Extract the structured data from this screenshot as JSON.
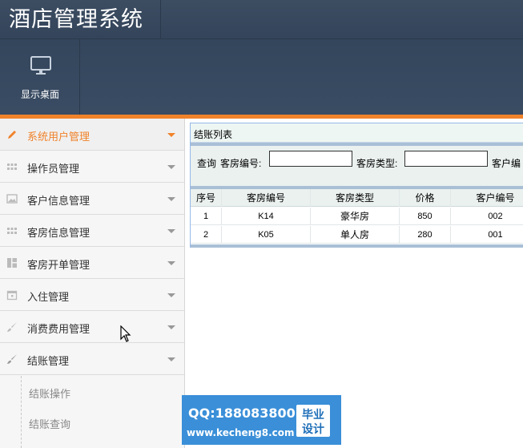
{
  "app": {
    "title": "酒店管理系统"
  },
  "toolbar": {
    "desktop_label": "显示桌面",
    "desktop_icon": "monitor-icon"
  },
  "sidebar": {
    "items": [
      {
        "label": "系统用户管理",
        "icon": "pencil-icon",
        "active": true
      },
      {
        "label": "操作员管理",
        "icon": "grid-icon"
      },
      {
        "label": "客户信息管理",
        "icon": "picture-icon"
      },
      {
        "label": "客房信息管理",
        "icon": "grid-icon"
      },
      {
        "label": "客房开单管理",
        "icon": "layout-icon"
      },
      {
        "label": "入住管理",
        "icon": "calendar-icon"
      },
      {
        "label": "消费费用管理",
        "icon": "brush-icon"
      },
      {
        "label": "结账管理",
        "icon": "brush-icon"
      }
    ],
    "subitems": [
      {
        "label": "结账操作"
      },
      {
        "label": "结账查询"
      }
    ]
  },
  "panel": {
    "title": "结账列表",
    "search": {
      "query_label": "查询",
      "room_no_label": "客房编号:",
      "room_no_value": "",
      "room_type_label": "客房类型:",
      "room_type_value": "",
      "customer_no_label": "客户编"
    },
    "table": {
      "columns": [
        "序号",
        "客房编号",
        "客房类型",
        "价格",
        "客户编号"
      ],
      "rows": [
        [
          "1",
          "K14",
          "豪华房",
          "850",
          "002"
        ],
        [
          "2",
          "K05",
          "单人房",
          "280",
          "001"
        ]
      ]
    }
  },
  "watermark": {
    "qq": "QQ:188083800",
    "site": "www.kecheng8.com",
    "badge_line1": "毕业",
    "badge_line2": "设计"
  },
  "colors": {
    "accent": "#f0822a",
    "header": "#3c4d62",
    "panel_border": "#95b8e7"
  }
}
